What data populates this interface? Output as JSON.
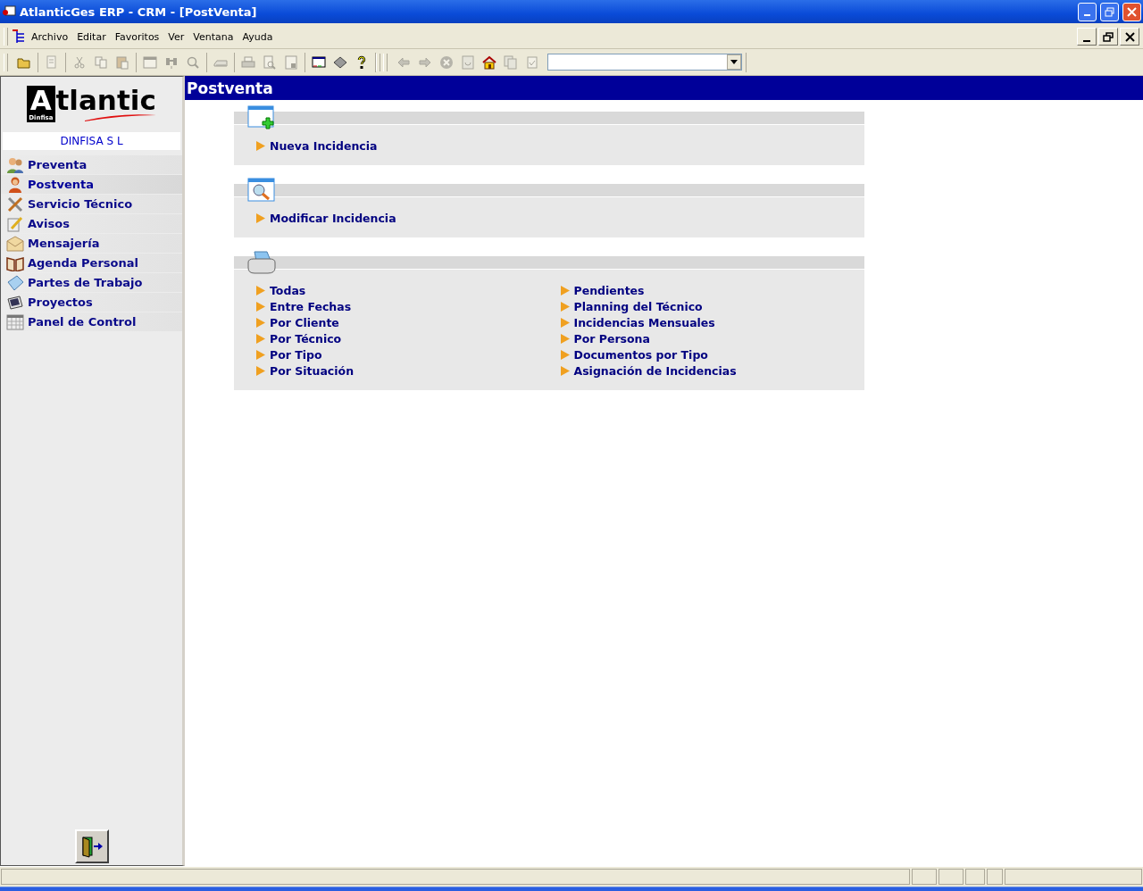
{
  "window": {
    "title": "AtlanticGes ERP - CRM - [PostVenta]"
  },
  "menu": [
    "Archivo",
    "Editar",
    "Favoritos",
    "Ver",
    "Ventana",
    "Ayuda"
  ],
  "toolbar": [
    [
      {
        "kind": "open",
        "disabled": false
      }
    ],
    [
      {
        "kind": "edit",
        "disabled": true
      }
    ],
    [
      {
        "kind": "cut",
        "disabled": true
      },
      {
        "kind": "copy",
        "disabled": true
      },
      {
        "kind": "paste",
        "disabled": true
      }
    ],
    [
      {
        "kind": "window",
        "disabled": true
      },
      {
        "kind": "binoculars",
        "disabled": true
      },
      {
        "kind": "search",
        "disabled": true
      }
    ],
    [
      {
        "kind": "scanner",
        "disabled": true
      }
    ],
    [
      {
        "kind": "print",
        "disabled": true
      },
      {
        "kind": "preview",
        "disabled": true
      },
      {
        "kind": "page",
        "disabled": true
      }
    ],
    [
      {
        "kind": "monitor",
        "disabled": false
      },
      {
        "kind": "tag",
        "disabled": false
      },
      {
        "kind": "help",
        "disabled": false
      }
    ],
    [
      {
        "kind": "back",
        "disabled": true
      },
      {
        "kind": "forward",
        "disabled": true
      },
      {
        "kind": "stop",
        "disabled": true
      },
      {
        "kind": "refresh",
        "disabled": true
      },
      {
        "kind": "home",
        "disabled": false
      },
      {
        "kind": "stack",
        "disabled": true
      },
      {
        "kind": "check",
        "disabled": true
      }
    ]
  ],
  "sidebar": {
    "logo_initial": "A",
    "logo": "tlantic",
    "logo_sub": "Dinfisa",
    "company": "DINFISA  S L",
    "items": [
      {
        "label": "Preventa",
        "kind": "people",
        "selected": false
      },
      {
        "label": "Postventa",
        "kind": "person",
        "selected": true
      },
      {
        "label": "Servicio Técnico",
        "kind": "tools",
        "selected": false
      },
      {
        "label": "Avisos",
        "kind": "pencil",
        "selected": false
      },
      {
        "label": "Mensajería",
        "kind": "envelope",
        "selected": false
      },
      {
        "label": "Agenda Personal",
        "kind": "book",
        "selected": false
      },
      {
        "label": "Partes de Trabajo",
        "kind": "paper",
        "selected": false
      },
      {
        "label": "Proyectos",
        "kind": "monitor",
        "selected": false
      },
      {
        "label": "Panel de Control",
        "kind": "grid",
        "selected": false
      }
    ]
  },
  "content": {
    "title": "Postventa",
    "sections": [
      {
        "kind": "new",
        "columns": [
          [
            "Nueva Incidencia"
          ]
        ]
      },
      {
        "kind": "search",
        "columns": [
          [
            "Modificar Incidencia"
          ]
        ]
      },
      {
        "kind": "print",
        "columns": [
          [
            "Todas",
            "Entre Fechas",
            "Por Cliente",
            "Por Técnico",
            "Por Tipo",
            "Por Situación"
          ],
          [
            "Pendientes",
            "Planning del Técnico",
            "Incidencias Mensuales",
            "Por Persona",
            "Documentos por Tipo",
            "Asignación de Incidencias"
          ]
        ]
      }
    ]
  }
}
